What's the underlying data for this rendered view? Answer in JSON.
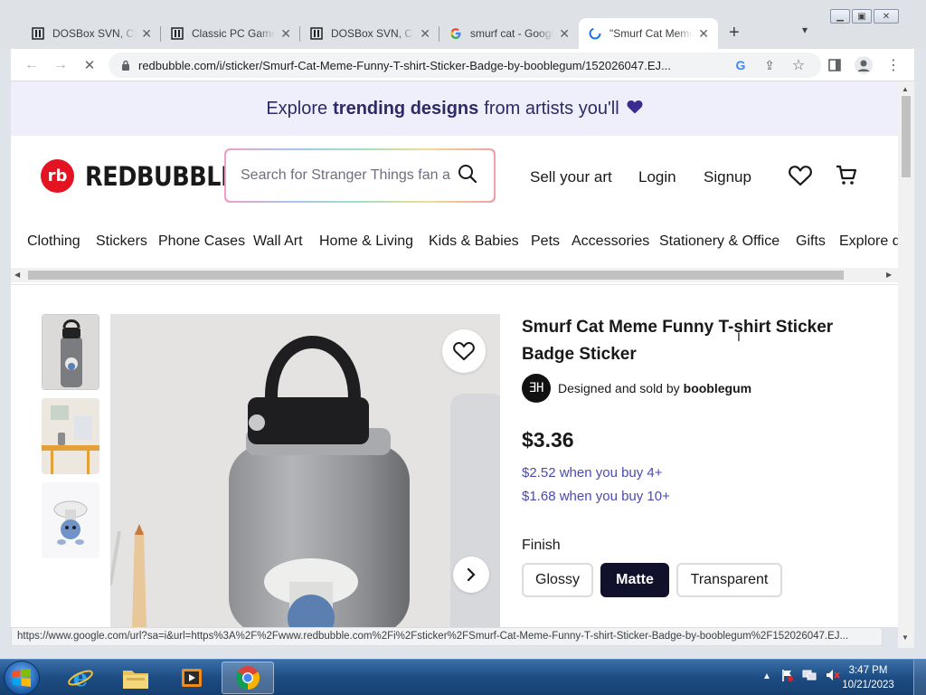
{
  "browser": {
    "tabs": [
      {
        "title": "DOSBox SVN, CPU"
      },
      {
        "title": "Classic PC Games"
      },
      {
        "title": "DOSBox SVN, CPU"
      },
      {
        "title": "smurf cat - Google"
      },
      {
        "title": "\"Smurf Cat Meme"
      }
    ],
    "url": "redbubble.com/i/sticker/Smurf-Cat-Meme-Funny-T-shirt-Sticker-Badge-by-booblegum/152026047.EJ...",
    "status_url": "https://www.google.com/url?sa=i&url=https%3A%2F%2Fwww.redbubble.com%2Fi%2Fsticker%2FSmurf-Cat-Meme-Funny-T-shirt-Sticker-Badge-by-booblegum%2F152026047.EJ..."
  },
  "promo": {
    "prefix": "Explore",
    "bold": "trending designs",
    "suffix": "from artists you'll"
  },
  "header": {
    "logo_text": "REDBUBBLE",
    "search_placeholder": "Search for Stranger Things fan art",
    "sell": "Sell your art",
    "login": "Login",
    "signup": "Signup"
  },
  "nav": [
    "Clothing",
    "Stickers",
    "Phone Cases",
    "Wall Art",
    "Home & Living",
    "Kids & Babies",
    "Pets",
    "Accessories",
    "Stationery & Office",
    "Gifts",
    "Explore designs"
  ],
  "product": {
    "title": "Smurf Cat Meme Funny T-shirt Sticker Badge Sticker",
    "seller_prefix": "Designed and sold by",
    "seller_name": "booblegum",
    "seller_initials": "ƎH",
    "price": "$3.36",
    "bulk": [
      "$2.52 when you buy 4+",
      "$1.68 when you buy 10+"
    ],
    "finish_label": "Finish",
    "finishes": [
      {
        "label": "Glossy",
        "selected": false
      },
      {
        "label": "Matte",
        "selected": true
      },
      {
        "label": "Transparent",
        "selected": false
      }
    ]
  },
  "taskbar": {
    "time": "3:47 PM",
    "date": "10/21/2023"
  },
  "colors": {
    "brand_red": "#e41321",
    "promo_bg": "#efeefb",
    "bulk_text": "#4a4ab3",
    "selected_finish": "#12112b"
  }
}
